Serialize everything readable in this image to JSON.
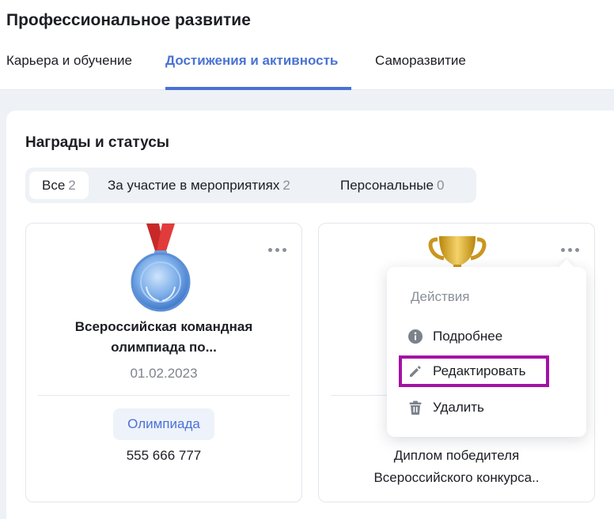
{
  "page": {
    "title": "Профессиональное развитие"
  },
  "tabs": [
    {
      "label": "Карьера и обучение",
      "active": false
    },
    {
      "label": "Достижения и активность",
      "active": true
    },
    {
      "label": "Саморазвитие",
      "active": false
    }
  ],
  "section": {
    "title": "Награды и статусы"
  },
  "filters": [
    {
      "label": "Все",
      "count": "2",
      "active": true
    },
    {
      "label": "За участие в мероприятиях",
      "count": "2",
      "active": false
    },
    {
      "label": "Персональные",
      "count": "0",
      "active": false
    }
  ],
  "cards": [
    {
      "icon": "medal-icon",
      "title_line1": "Всероссийская командная",
      "title_line2": "олимпиада по...",
      "date": "01.02.2023",
      "tag": "Олимпиада",
      "number": "555 666 777"
    },
    {
      "icon": "trophy-icon",
      "desc_line1": "Диплом победителя",
      "desc_line2": "Всероссийского конкурса.."
    }
  ],
  "menu": {
    "heading": "Действия",
    "items": [
      {
        "label": "Подробнее",
        "icon": "info-icon"
      },
      {
        "label": "Редактировать",
        "icon": "pencil-icon",
        "highlighted": true
      },
      {
        "label": "Удалить",
        "icon": "trash-icon"
      }
    ]
  },
  "colors": {
    "accent": "#4a72d4",
    "highlight": "#a312a6",
    "background": "#eef1f6",
    "muted": "#8a9099"
  }
}
